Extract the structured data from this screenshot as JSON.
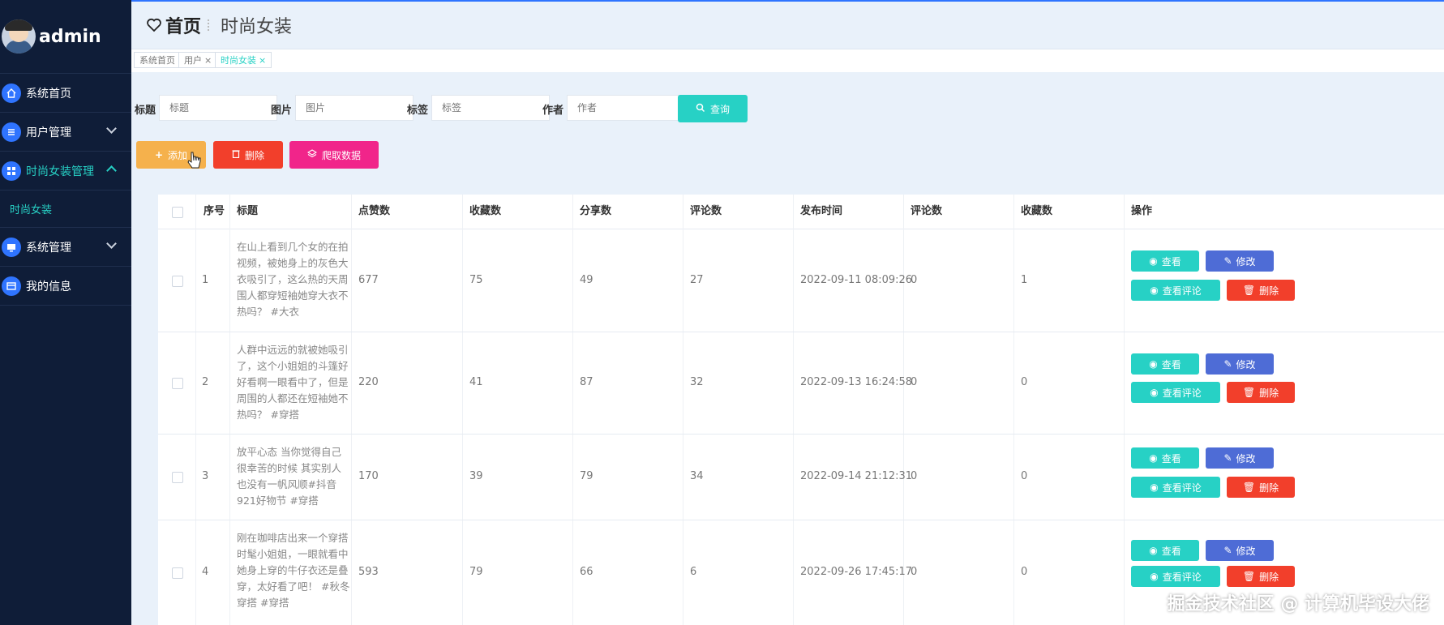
{
  "brand": {
    "name": "admin"
  },
  "sidebar": {
    "items": [
      {
        "label": "系统首页",
        "icon": "home-icon"
      },
      {
        "label": "用户管理",
        "icon": "list-icon"
      },
      {
        "label": "时尚女装管理",
        "icon": "grid-icon"
      },
      {
        "label": "时尚女装"
      },
      {
        "label": "系统管理",
        "icon": "monitor-icon"
      },
      {
        "label": "我的信息",
        "icon": "card-icon"
      }
    ]
  },
  "header": {
    "home": "首页",
    "current": "时尚女装"
  },
  "tabs": [
    {
      "label": "系统首页"
    },
    {
      "label": "用户",
      "close": "×"
    },
    {
      "label": "时尚女装",
      "close": "×"
    }
  ],
  "search": {
    "title_label": "标题",
    "title_placeholder": "标题",
    "image_label": "图片",
    "image_placeholder": "图片",
    "tag_label": "标签",
    "tag_placeholder": "标签",
    "author_label": "作者",
    "author_placeholder": "作者",
    "query_button": "查询"
  },
  "toolbar": {
    "add": "添加",
    "delete": "删除",
    "crawl": "爬取数据"
  },
  "table": {
    "headers": [
      "序号",
      "标题",
      "点赞数",
      "收藏数",
      "分享数",
      "评论数",
      "发布时间",
      "评论数",
      "收藏数",
      "操作"
    ],
    "actions": {
      "view": "查看",
      "edit": "修改",
      "view_comments": "查看评论",
      "delete": "删除"
    },
    "rows": [
      {
        "index": "1",
        "title": "在山上看到几个女的在拍视频，被她身上的灰色大衣吸引了，这么热的天周围人都穿短袖她穿大衣不热吗？ #大衣",
        "likes": "677",
        "favorites": "75",
        "shares": "49",
        "comments": "27",
        "published": "2022-09-11 08:09:26",
        "comments2": "0",
        "favorites2": "1"
      },
      {
        "index": "2",
        "title": "人群中远远的就被她吸引了，这个小姐姐的斗篷好好看啊一眼看中了，但是周围的人都还在短袖她不热吗？ #穿搭",
        "likes": "220",
        "favorites": "41",
        "shares": "87",
        "comments": "32",
        "published": "2022-09-13 16:24:58",
        "comments2": "0",
        "favorites2": "0"
      },
      {
        "index": "3",
        "title": "放平心态 当你觉得自己很幸苦的时候 其实别人也没有一帆风顺#抖音921好物节 #穿搭",
        "likes": "170",
        "favorites": "39",
        "shares": "79",
        "comments": "34",
        "published": "2022-09-14 21:12:31",
        "comments2": "0",
        "favorites2": "0"
      },
      {
        "index": "4",
        "title": "刚在咖啡店出来一个穿搭时髦小姐姐，一眼就看中她身上穿的牛仔衣还是叠穿，太好看了吧！ #秋冬穿搭 #穿搭",
        "likes": "593",
        "favorites": "79",
        "shares": "66",
        "comments": "6",
        "published": "2022-09-26 17:45:17",
        "comments2": "0",
        "favorites2": "0"
      }
    ]
  },
  "watermark": "掘金技术社区 @ 计算机毕设大佬",
  "colors": {
    "sidebar": "#0f1d38",
    "accent": "#27d1c5",
    "primary": "#2f74ff"
  }
}
